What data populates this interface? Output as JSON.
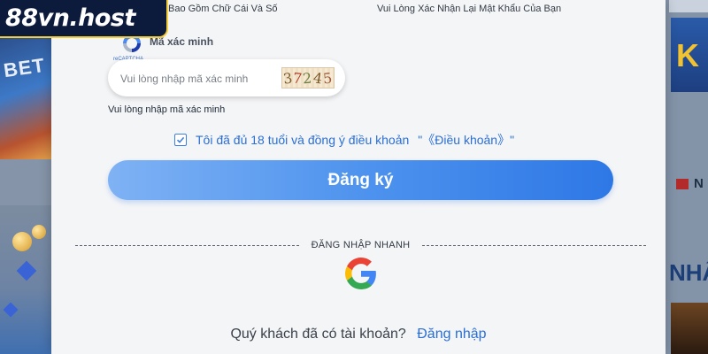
{
  "brand": {
    "logo_text": "88vn.host"
  },
  "background": {
    "left_banner_text": "BET",
    "right_banner_letter": "K",
    "right_lang_text": "N",
    "right_title_text": "NHẬ"
  },
  "form": {
    "password_hint": "Bao Gồm Chữ Cái Và Số",
    "confirm_password_hint": "Vui Lòng Xác Nhận Lại Mật Khẩu Của Bạn",
    "recaptcha_label": "reCAPTCHA",
    "captcha_title": "Mã xác minh",
    "captcha_placeholder": "Vui lòng nhập mã xác minh",
    "captcha_code": [
      "3",
      "7",
      "2",
      "4",
      "5"
    ],
    "captcha_help": "Vui lòng nhập mã xác minh",
    "agree_checked": true,
    "agree_text": "Tôi đã đủ 18 tuổi và đồng ý điều khoản",
    "terms_link": "\"《Điều khoản》\"",
    "register_button": "Đăng ký",
    "quick_login_label": "ĐĂNG NHẬP NHANH",
    "quick_login_provider_icon": "google-icon",
    "have_account_text": "Quý khách đã có tài khoản?",
    "login_link": "Đăng nhập"
  },
  "colors": {
    "accent": "#2e78e6",
    "link": "#2a6fd6",
    "modal_bg": "#f4f5f7",
    "logo_bg": "#0c1a3c",
    "logo_border": "#f5cf3a"
  }
}
